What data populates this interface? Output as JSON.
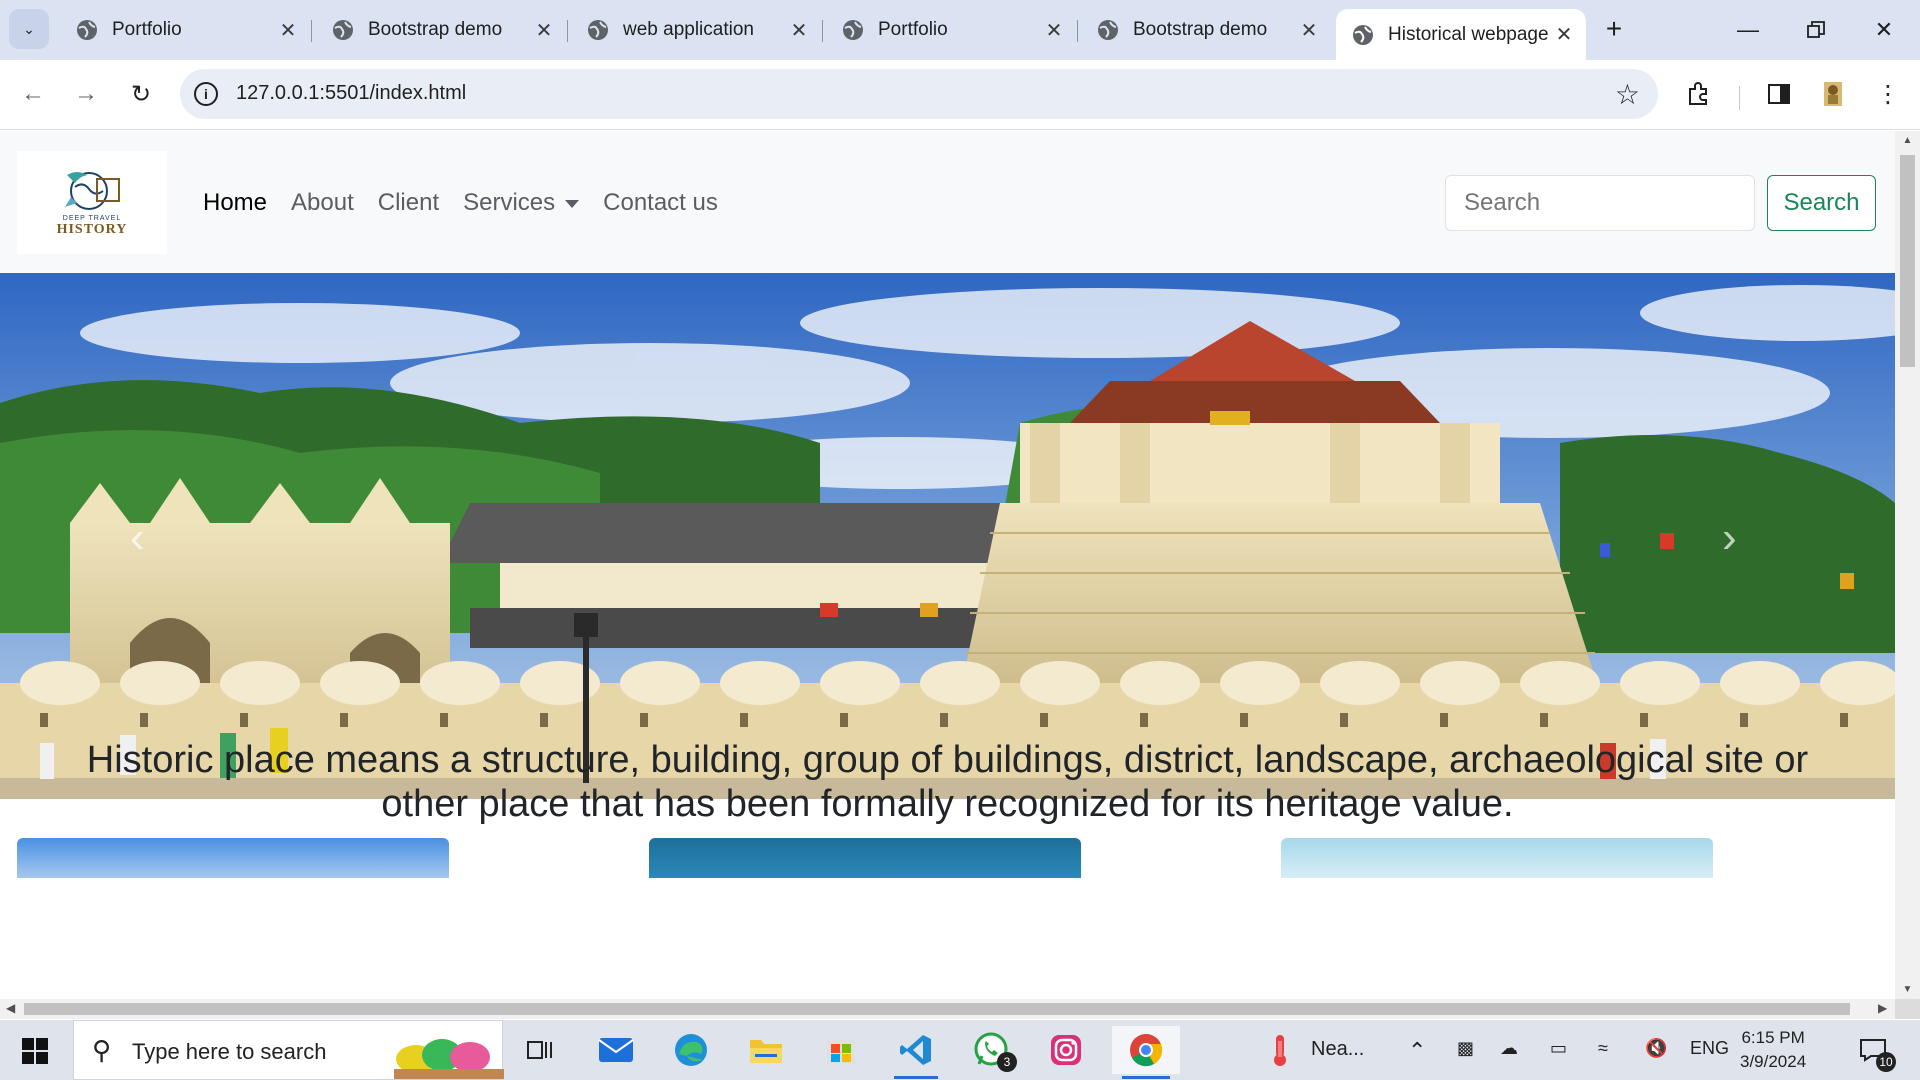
{
  "browser": {
    "tabs": [
      {
        "label": "Portfolio"
      },
      {
        "label": "Bootstrap demo"
      },
      {
        "label": "web application"
      },
      {
        "label": "Portfolio"
      },
      {
        "label": "Bootstrap demo"
      },
      {
        "label": "Historical webpage"
      }
    ],
    "url": "127.0.0.1:5501/index.html"
  },
  "site": {
    "logo_small": "DEEP TRAVEL",
    "logo_big": "HISTORY",
    "nav": [
      "Home",
      "About",
      "Client",
      "Services",
      "Contact us"
    ],
    "search_placeholder": "Search",
    "search_button": "Search"
  },
  "main": {
    "headline": "Historic place means a structure, building, group of buildings, district, landscape, archaeological site or other place that has been formally recognized for its heritage value."
  },
  "taskbar": {
    "search_placeholder": "Type here to search",
    "weather_text": "Nea...",
    "language": "ENG",
    "time": "6:15 PM",
    "date": "3/9/2024",
    "whatsapp_badge": "3",
    "notification_count": "10"
  },
  "colors": {
    "accent_green": "#198754",
    "tab_strip": "#dbe3f3",
    "omnibox": "#e9eef6"
  }
}
